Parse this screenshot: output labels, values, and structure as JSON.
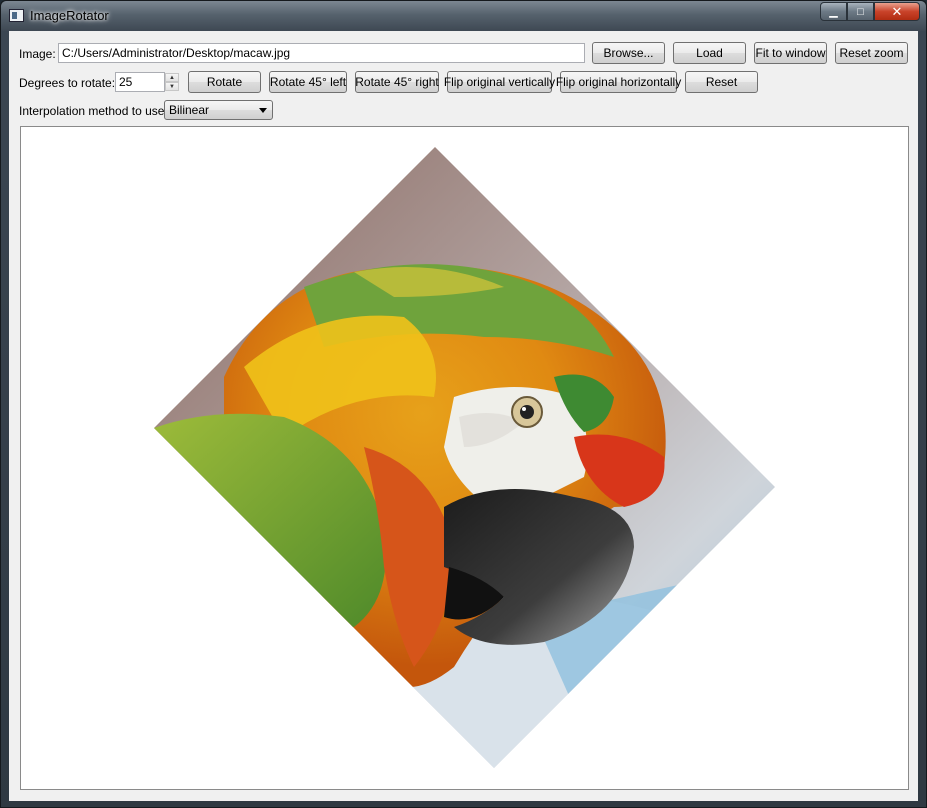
{
  "window": {
    "title": "ImageRotator"
  },
  "titlebar": {
    "minimize_icon": "minimize-icon",
    "maximize_icon": "maximize-icon",
    "close_icon": "close-icon"
  },
  "toolbar": {
    "image_label": "Image:",
    "image_path": "C:/Users/Administrator/Desktop/macaw.jpg",
    "browse_label": "Browse...",
    "load_label": "Load",
    "fit_label": "Fit to window",
    "reset_zoom_label": "Reset zoom",
    "degrees_label": "Degrees to rotate:",
    "degrees_value": "25",
    "rotate_label": "Rotate",
    "rotate_left_label": "Rotate 45° left",
    "rotate_right_label": "Rotate 45° right",
    "flip_vertical_label": "Flip original vertically",
    "flip_horizontal_label": "Flip original horizontally",
    "reset_label": "Reset",
    "interpolation_label": "Interpolation method to use:",
    "interpolation_value": "Bilinear"
  },
  "canvas": {
    "image_subject": "macaw-photo",
    "colors": {
      "background": "#ffffff"
    }
  }
}
